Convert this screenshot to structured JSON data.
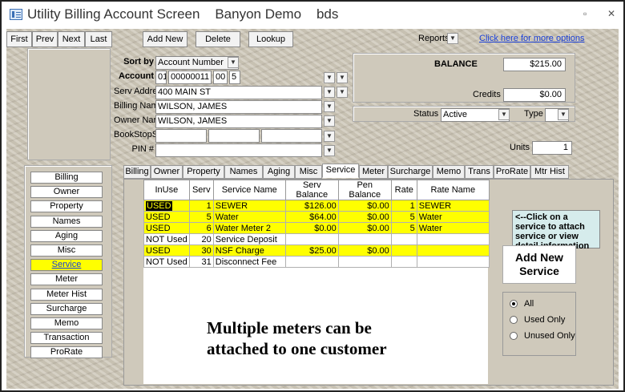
{
  "window": {
    "title": "Utility Billing Account Screen    Banyon Demo    bds",
    "restore_glyph": "▫",
    "close_glyph": "✕"
  },
  "toolbar": {
    "first": "First",
    "prev": "Prev",
    "next": "Next",
    "last": "Last",
    "add_new": "Add New",
    "delete": "Delete",
    "lookup": "Lookup",
    "reports": "Reports",
    "more_options": "Click here for more options"
  },
  "account": {
    "sort_by_label": "Sort by",
    "sort_by_value": "Account Number",
    "account_label": "Account",
    "account_parts": [
      "01",
      "00000011",
      "00",
      "5"
    ],
    "serv_address_label": "Serv Address",
    "serv_address": "400 MAIN ST",
    "billing_name_label": "Billing Name",
    "billing_name": "WILSON, JAMES",
    "owner_name_label": "Owner Name",
    "owner_name": "WILSON, JAMES",
    "bookstopsub_label": "BookStopSub",
    "pin_label": "PIN #",
    "pin": ""
  },
  "balance": {
    "balance_label": "BALANCE",
    "balance_value": "$215.00",
    "credits_label": "Credits",
    "credits_value": "$0.00",
    "status_label": "Status",
    "status_value": "Active",
    "type_label": "Type",
    "type_value": "",
    "units_label": "Units",
    "units_value": "1"
  },
  "nav": {
    "items": [
      "Billing",
      "Owner",
      "Property",
      "Names",
      "Aging",
      "Misc",
      "Service",
      "Meter",
      "Meter Hist",
      "Surcharge",
      "Memo",
      "Transaction",
      "ProRate"
    ],
    "active": "Service"
  },
  "tabs": [
    "Billing",
    "Owner",
    "Property",
    "Names",
    "Aging",
    "Misc",
    "Service",
    "Meter",
    "Surcharge",
    "Memo",
    "Trans",
    "ProRate",
    "Mtr Hist"
  ],
  "grid": {
    "headers": [
      "InUse",
      "Serv",
      "Service Name",
      "Serv Balance",
      "Pen Balance",
      "Rate",
      "Rate Name"
    ],
    "rows": [
      {
        "inuse": "USED",
        "serv": "1",
        "name": "SEWER",
        "serv_bal": "$126.00",
        "pen_bal": "$0.00",
        "rate": "1",
        "rate_name": "SEWER",
        "style": "yellow"
      },
      {
        "inuse": "USED",
        "serv": "5",
        "name": "Water",
        "serv_bal": "$64.00",
        "pen_bal": "$0.00",
        "rate": "5",
        "rate_name": "Water",
        "style": "yellow"
      },
      {
        "inuse": "USED",
        "serv": "6",
        "name": "Water Meter 2",
        "serv_bal": "$0.00",
        "pen_bal": "$0.00",
        "rate": "5",
        "rate_name": "Water",
        "style": "yellow"
      },
      {
        "inuse": "NOT Used",
        "serv": "20",
        "name": "Service Deposit",
        "serv_bal": "",
        "pen_bal": "",
        "rate": "",
        "rate_name": "",
        "style": "white"
      },
      {
        "inuse": "USED",
        "serv": "30",
        "name": "NSF Charge",
        "serv_bal": "$25.00",
        "pen_bal": "$0.00",
        "rate": "",
        "rate_name": "",
        "style": "yellow"
      },
      {
        "inuse": "NOT Used",
        "serv": "31",
        "name": "Disconnect Fee",
        "serv_bal": "",
        "pen_bal": "",
        "rate": "",
        "rate_name": "",
        "style": "white"
      }
    ]
  },
  "side": {
    "hint": "<--Click on a service to attach service or view detail information",
    "add_new_service": "Add New Service",
    "filter_all": "All",
    "filter_used": "Used Only",
    "filter_unused": "Unused Only",
    "filter_selected": "All"
  },
  "annotation": {
    "line1": "Multiple meters can be",
    "line2": "attached to one customer"
  }
}
